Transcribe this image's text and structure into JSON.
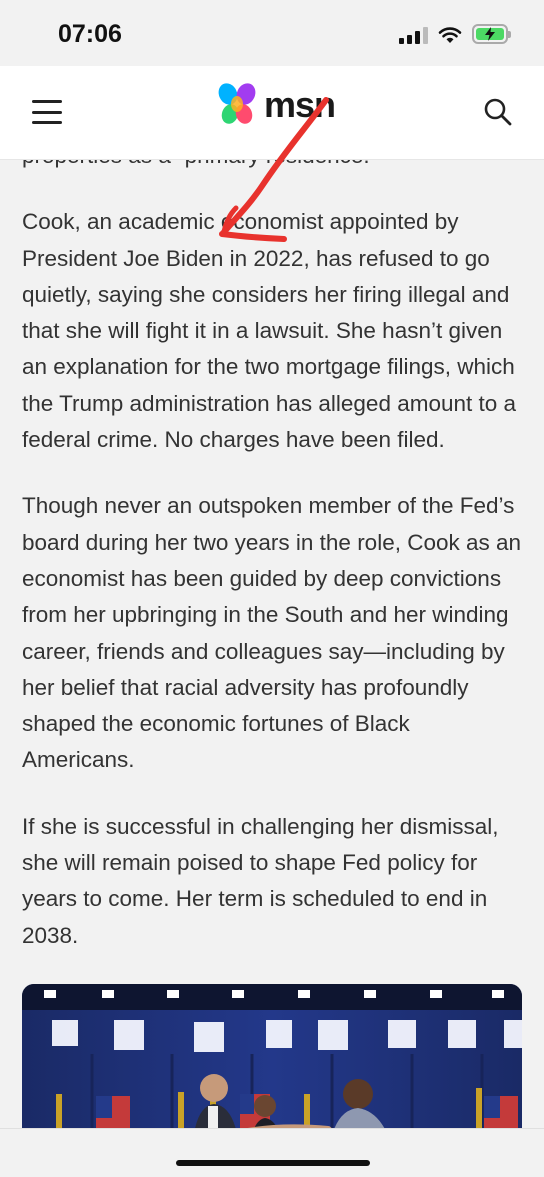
{
  "status": {
    "time": "07:06",
    "icons": [
      "cellular-signal-icon",
      "wifi-icon",
      "battery-charging-icon"
    ]
  },
  "header": {
    "logo_text": "msn",
    "icons": [
      "hamburger-menu-icon",
      "msn-butterfly-logo",
      "search-icon"
    ]
  },
  "article": {
    "partial_line": "properties as a “primary residence.”",
    "paragraphs": [
      "Cook, an academic economist appointed by President Joe Biden in 2022, has refused to go quietly, saying she considers her firing illegal and that she will fight it in a lawsuit. She hasn’t given an explanation for the two mortgage filings, which the Trump administration has alleged amount to a federal crime. No charges have been filed.",
      "Though never an outspoken member of the Fed’s board during her two years in the role, Cook as an economist has been guided by deep convictions from her upbringing in the South and her winding career, friends and colleagues say—including by her belief that racial adversity has profoundly shaped the economic fortunes of Black Americans.",
      "If she is successful in challenging her dismissal, she will remain poised to shape Fed policy for years to come. Her term is scheduled to end in 2038."
    ]
  },
  "colors": {
    "annotation_arrow": "#e8322d",
    "image_backdrop": "#1c2d6b"
  }
}
